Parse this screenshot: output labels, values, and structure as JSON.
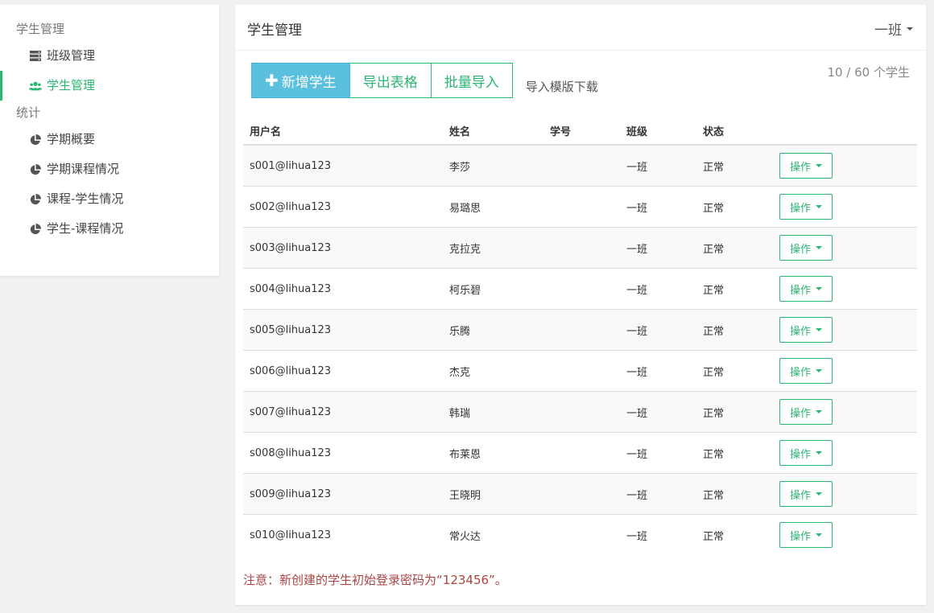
{
  "sidebar": {
    "section_manage": "学生管理",
    "item_class": "班级管理",
    "item_student": "学生管理",
    "section_stats": "统计",
    "item_term_overview": "学期概要",
    "item_term_course": "学期课程情况",
    "item_course_student": "课程-学生情况",
    "item_student_course": "学生-课程情况"
  },
  "header": {
    "title": "学生管理",
    "class_select": "一班"
  },
  "toolbar": {
    "add_label": "新增学生",
    "export_label": "导出表格",
    "import_label": "批量导入",
    "template_link": "导入模版下载",
    "count": "10 / 60 个学生"
  },
  "table": {
    "columns": [
      "用户名",
      "姓名",
      "学号",
      "班级",
      "状态",
      ""
    ],
    "action_label": "操作",
    "rows": [
      {
        "username": "s001@lihua123",
        "name": "李莎",
        "student_no": "",
        "class": "一班",
        "status": "正常"
      },
      {
        "username": "s002@lihua123",
        "name": "易璐思",
        "student_no": "",
        "class": "一班",
        "status": "正常"
      },
      {
        "username": "s003@lihua123",
        "name": "克拉克",
        "student_no": "",
        "class": "一班",
        "status": "正常"
      },
      {
        "username": "s004@lihua123",
        "name": "柯乐碧",
        "student_no": "",
        "class": "一班",
        "status": "正常"
      },
      {
        "username": "s005@lihua123",
        "name": "乐腾",
        "student_no": "",
        "class": "一班",
        "status": "正常"
      },
      {
        "username": "s006@lihua123",
        "name": "杰克",
        "student_no": "",
        "class": "一班",
        "status": "正常"
      },
      {
        "username": "s007@lihua123",
        "name": "韩瑞",
        "student_no": "",
        "class": "一班",
        "status": "正常"
      },
      {
        "username": "s008@lihua123",
        "name": "布莱恩",
        "student_no": "",
        "class": "一班",
        "status": "正常"
      },
      {
        "username": "s009@lihua123",
        "name": "王晓明",
        "student_no": "",
        "class": "一班",
        "status": "正常"
      },
      {
        "username": "s010@lihua123",
        "name": "常火达",
        "student_no": "",
        "class": "一班",
        "status": "正常"
      }
    ]
  },
  "notice": "注意：新创建的学生初始登录密码为“123456”。",
  "colors": {
    "accent": "#2bb673",
    "primary_button": "#5bc0de",
    "notice": "#a94442"
  }
}
